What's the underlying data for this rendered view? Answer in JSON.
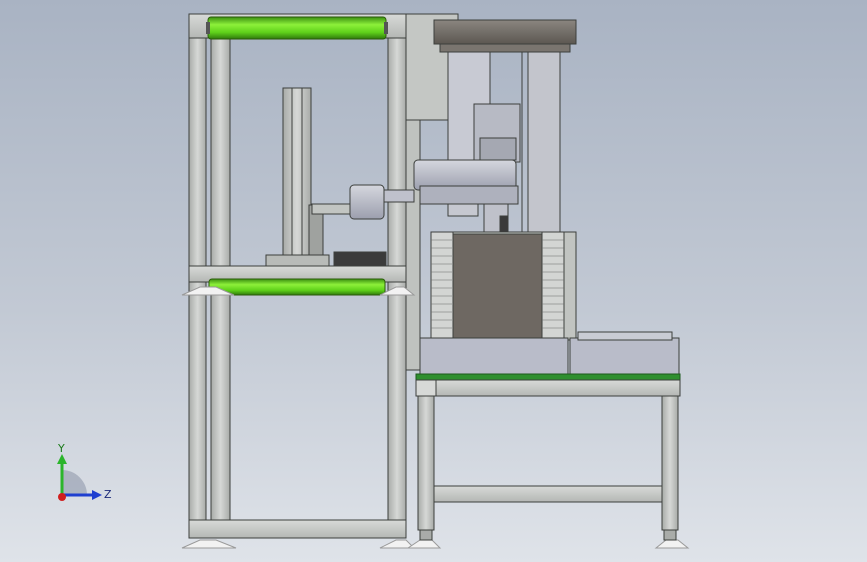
{
  "viewport": {
    "background_top": "#a9b3c3",
    "background_bottom": "#dfe3e9"
  },
  "model": {
    "frame_color": "#c9ccc9",
    "frame_edge": "#3c3f3c",
    "roller_color": "#5fd11a",
    "robot_color": "#b9bcc8",
    "conveyor_belt_color": "#2f8f2f",
    "stack_body_color": "#6e6862"
  },
  "triad": {
    "y_label": "Y",
    "z_label": "Z",
    "y_color": "#2bb52b",
    "z_color": "#1f3fd0",
    "x_color": "#d01f1f"
  }
}
